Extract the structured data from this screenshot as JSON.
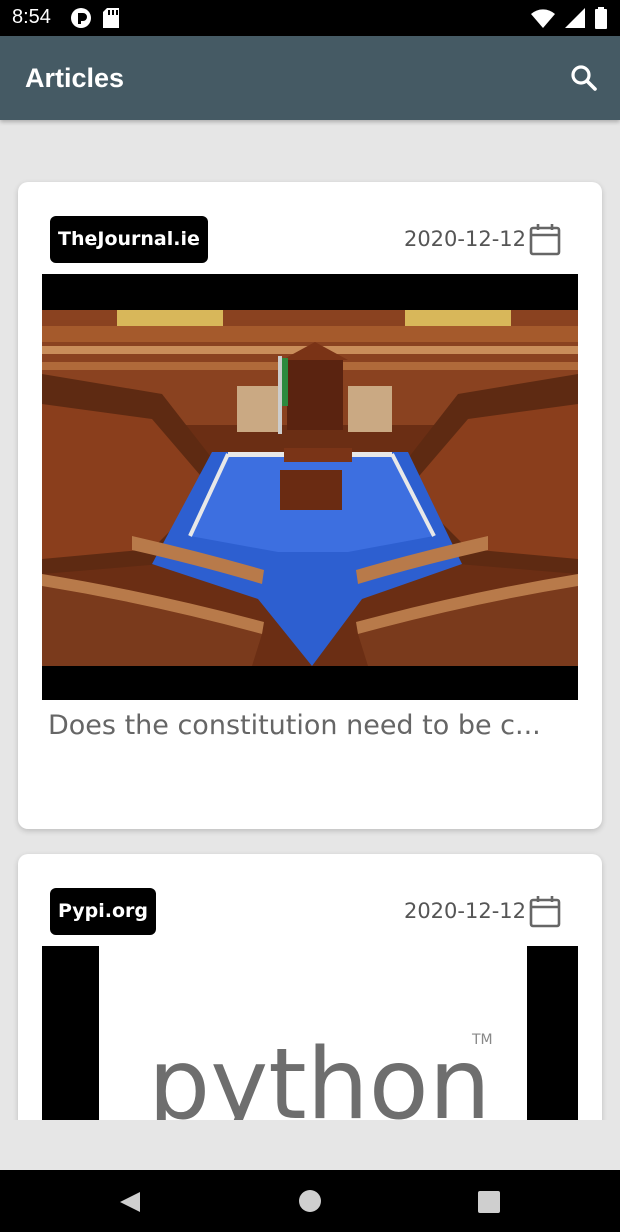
{
  "status_bar": {
    "time": "8:54",
    "icons": [
      "pocket-casts-icon",
      "sd-card-icon",
      "wifi-icon",
      "signal-icon",
      "battery-icon"
    ]
  },
  "app_bar": {
    "title": "Articles",
    "search_icon": "search-icon"
  },
  "articles": [
    {
      "source": "TheJournal.ie",
      "date": "2020-12-12",
      "title": "Does the constitution need to be c..."
    },
    {
      "source": "Pypi.org",
      "date": "2020-12-12",
      "image_text": "python",
      "image_tm": "TM"
    }
  ],
  "nav_bar": {
    "icons": [
      "back-icon",
      "home-icon",
      "recents-icon"
    ]
  },
  "colors": {
    "app_bar": "#455a64",
    "background": "#e6e6e6",
    "badge": "#000000",
    "dail_carpet": "#2d5fd0",
    "dail_wood": "#7a3a1c"
  }
}
